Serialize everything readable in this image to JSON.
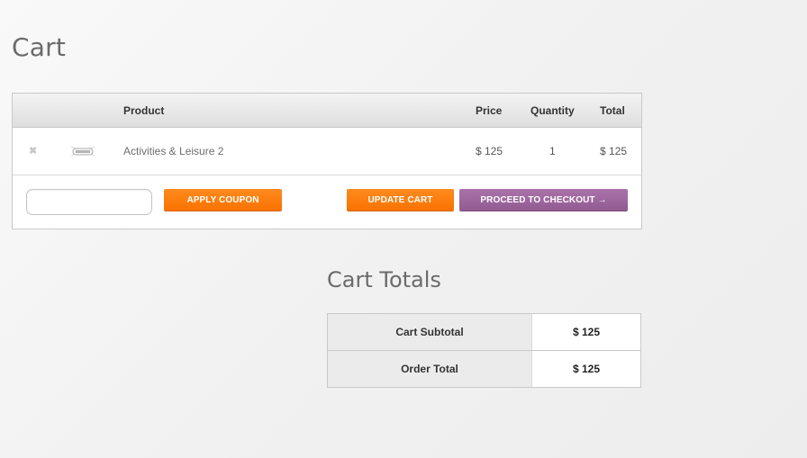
{
  "page": {
    "title": "Cart"
  },
  "cart_table": {
    "columns": {
      "product": "Product",
      "price": "Price",
      "quantity": "Quantity",
      "total": "Total"
    },
    "items": [
      {
        "remove_icon": "close-icon",
        "thumbnail": "product-thumbnail",
        "name": "Activities & Leisure 2",
        "price": "$ 125",
        "quantity": "1",
        "total": "$ 125"
      }
    ]
  },
  "actions": {
    "coupon": {
      "value": "",
      "placeholder": ""
    },
    "apply_coupon_label": "Apply Coupon",
    "update_cart_label": "Update Cart",
    "checkout_label": "Proceed to Checkout →"
  },
  "totals": {
    "title": "Cart Totals",
    "rows": [
      {
        "label": "Cart Subtotal",
        "value": "$ 125"
      },
      {
        "label": "Order Total",
        "value": "$ 125"
      }
    ]
  },
  "colors": {
    "accent_orange": "#f97300",
    "accent_purple": "#925b92",
    "border": "#c9c9c9",
    "title_text": "#6b6b6b"
  }
}
